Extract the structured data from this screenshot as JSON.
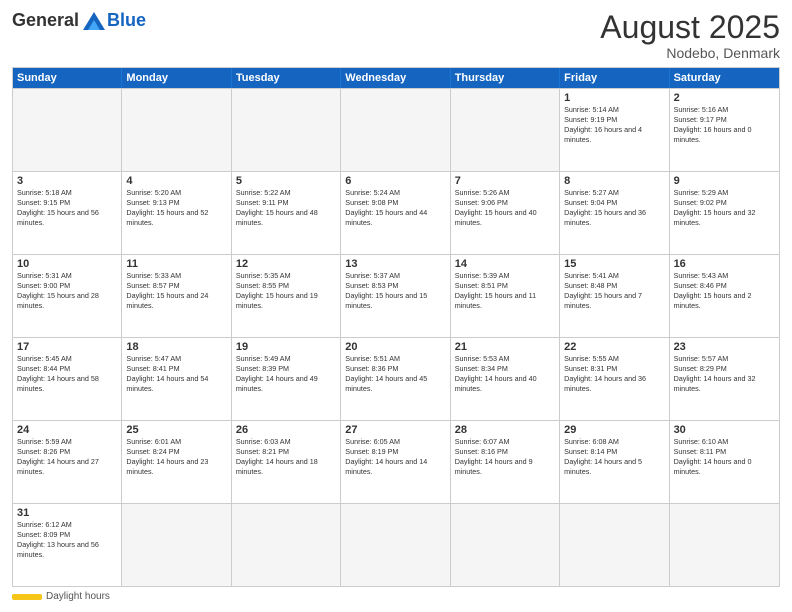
{
  "logo": {
    "general": "General",
    "blue": "Blue"
  },
  "title": "August 2025",
  "location": "Nodebo, Denmark",
  "days_of_week": [
    "Sunday",
    "Monday",
    "Tuesday",
    "Wednesday",
    "Thursday",
    "Friday",
    "Saturday"
  ],
  "legend": {
    "daylight_hours": "Daylight hours"
  },
  "weeks": [
    [
      {
        "day": "",
        "empty": true
      },
      {
        "day": "",
        "empty": true
      },
      {
        "day": "",
        "empty": true
      },
      {
        "day": "",
        "empty": true
      },
      {
        "day": "",
        "empty": true
      },
      {
        "day": "1",
        "sunrise": "Sunrise: 5:14 AM",
        "sunset": "Sunset: 9:19 PM",
        "daylight": "Daylight: 16 hours and 4 minutes."
      },
      {
        "day": "2",
        "sunrise": "Sunrise: 5:16 AM",
        "sunset": "Sunset: 9:17 PM",
        "daylight": "Daylight: 16 hours and 0 minutes."
      }
    ],
    [
      {
        "day": "3",
        "sunrise": "Sunrise: 5:18 AM",
        "sunset": "Sunset: 9:15 PM",
        "daylight": "Daylight: 15 hours and 56 minutes."
      },
      {
        "day": "4",
        "sunrise": "Sunrise: 5:20 AM",
        "sunset": "Sunset: 9:13 PM",
        "daylight": "Daylight: 15 hours and 52 minutes."
      },
      {
        "day": "5",
        "sunrise": "Sunrise: 5:22 AM",
        "sunset": "Sunset: 9:11 PM",
        "daylight": "Daylight: 15 hours and 48 minutes."
      },
      {
        "day": "6",
        "sunrise": "Sunrise: 5:24 AM",
        "sunset": "Sunset: 9:08 PM",
        "daylight": "Daylight: 15 hours and 44 minutes."
      },
      {
        "day": "7",
        "sunrise": "Sunrise: 5:26 AM",
        "sunset": "Sunset: 9:06 PM",
        "daylight": "Daylight: 15 hours and 40 minutes."
      },
      {
        "day": "8",
        "sunrise": "Sunrise: 5:27 AM",
        "sunset": "Sunset: 9:04 PM",
        "daylight": "Daylight: 15 hours and 36 minutes."
      },
      {
        "day": "9",
        "sunrise": "Sunrise: 5:29 AM",
        "sunset": "Sunset: 9:02 PM",
        "daylight": "Daylight: 15 hours and 32 minutes."
      }
    ],
    [
      {
        "day": "10",
        "sunrise": "Sunrise: 5:31 AM",
        "sunset": "Sunset: 9:00 PM",
        "daylight": "Daylight: 15 hours and 28 minutes."
      },
      {
        "day": "11",
        "sunrise": "Sunrise: 5:33 AM",
        "sunset": "Sunset: 8:57 PM",
        "daylight": "Daylight: 15 hours and 24 minutes."
      },
      {
        "day": "12",
        "sunrise": "Sunrise: 5:35 AM",
        "sunset": "Sunset: 8:55 PM",
        "daylight": "Daylight: 15 hours and 19 minutes."
      },
      {
        "day": "13",
        "sunrise": "Sunrise: 5:37 AM",
        "sunset": "Sunset: 8:53 PM",
        "daylight": "Daylight: 15 hours and 15 minutes."
      },
      {
        "day": "14",
        "sunrise": "Sunrise: 5:39 AM",
        "sunset": "Sunset: 8:51 PM",
        "daylight": "Daylight: 15 hours and 11 minutes."
      },
      {
        "day": "15",
        "sunrise": "Sunrise: 5:41 AM",
        "sunset": "Sunset: 8:48 PM",
        "daylight": "Daylight: 15 hours and 7 minutes."
      },
      {
        "day": "16",
        "sunrise": "Sunrise: 5:43 AM",
        "sunset": "Sunset: 8:46 PM",
        "daylight": "Daylight: 15 hours and 2 minutes."
      }
    ],
    [
      {
        "day": "17",
        "sunrise": "Sunrise: 5:45 AM",
        "sunset": "Sunset: 8:44 PM",
        "daylight": "Daylight: 14 hours and 58 minutes."
      },
      {
        "day": "18",
        "sunrise": "Sunrise: 5:47 AM",
        "sunset": "Sunset: 8:41 PM",
        "daylight": "Daylight: 14 hours and 54 minutes."
      },
      {
        "day": "19",
        "sunrise": "Sunrise: 5:49 AM",
        "sunset": "Sunset: 8:39 PM",
        "daylight": "Daylight: 14 hours and 49 minutes."
      },
      {
        "day": "20",
        "sunrise": "Sunrise: 5:51 AM",
        "sunset": "Sunset: 8:36 PM",
        "daylight": "Daylight: 14 hours and 45 minutes."
      },
      {
        "day": "21",
        "sunrise": "Sunrise: 5:53 AM",
        "sunset": "Sunset: 8:34 PM",
        "daylight": "Daylight: 14 hours and 40 minutes."
      },
      {
        "day": "22",
        "sunrise": "Sunrise: 5:55 AM",
        "sunset": "Sunset: 8:31 PM",
        "daylight": "Daylight: 14 hours and 36 minutes."
      },
      {
        "day": "23",
        "sunrise": "Sunrise: 5:57 AM",
        "sunset": "Sunset: 8:29 PM",
        "daylight": "Daylight: 14 hours and 32 minutes."
      }
    ],
    [
      {
        "day": "24",
        "sunrise": "Sunrise: 5:59 AM",
        "sunset": "Sunset: 8:26 PM",
        "daylight": "Daylight: 14 hours and 27 minutes."
      },
      {
        "day": "25",
        "sunrise": "Sunrise: 6:01 AM",
        "sunset": "Sunset: 8:24 PM",
        "daylight": "Daylight: 14 hours and 23 minutes."
      },
      {
        "day": "26",
        "sunrise": "Sunrise: 6:03 AM",
        "sunset": "Sunset: 8:21 PM",
        "daylight": "Daylight: 14 hours and 18 minutes."
      },
      {
        "day": "27",
        "sunrise": "Sunrise: 6:05 AM",
        "sunset": "Sunset: 8:19 PM",
        "daylight": "Daylight: 14 hours and 14 minutes."
      },
      {
        "day": "28",
        "sunrise": "Sunrise: 6:07 AM",
        "sunset": "Sunset: 8:16 PM",
        "daylight": "Daylight: 14 hours and 9 minutes."
      },
      {
        "day": "29",
        "sunrise": "Sunrise: 6:08 AM",
        "sunset": "Sunset: 8:14 PM",
        "daylight": "Daylight: 14 hours and 5 minutes."
      },
      {
        "day": "30",
        "sunrise": "Sunrise: 6:10 AM",
        "sunset": "Sunset: 8:11 PM",
        "daylight": "Daylight: 14 hours and 0 minutes."
      }
    ],
    [
      {
        "day": "31",
        "sunrise": "Sunrise: 6:12 AM",
        "sunset": "Sunset: 8:09 PM",
        "daylight": "Daylight: 13 hours and 56 minutes."
      },
      {
        "day": "",
        "empty": true
      },
      {
        "day": "",
        "empty": true
      },
      {
        "day": "",
        "empty": true
      },
      {
        "day": "",
        "empty": true
      },
      {
        "day": "",
        "empty": true
      },
      {
        "day": "",
        "empty": true
      }
    ]
  ]
}
